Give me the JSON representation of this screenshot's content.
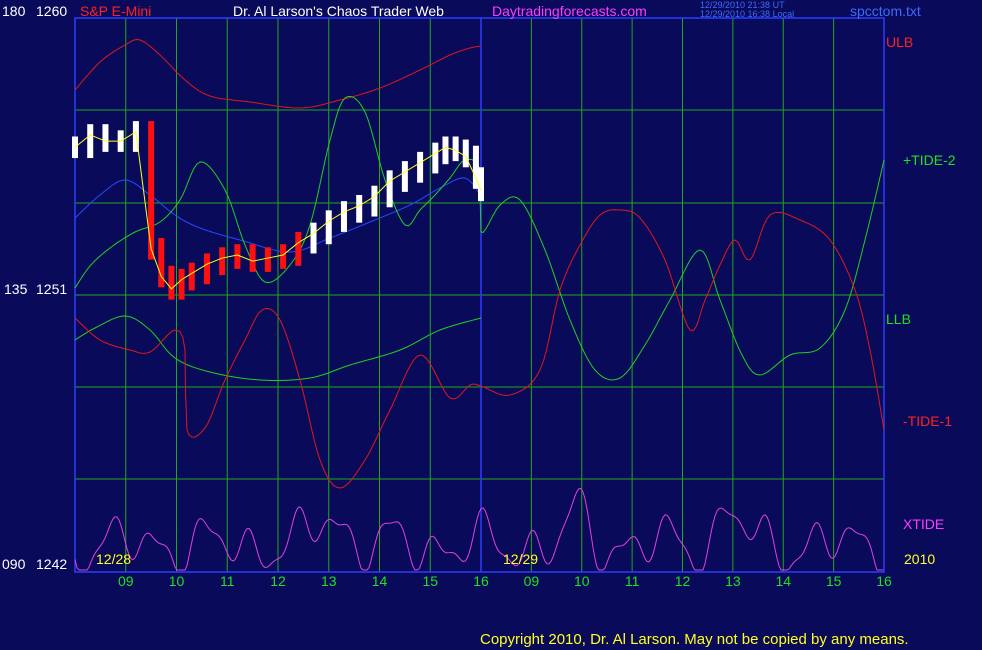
{
  "header": {
    "y_left_top": "180",
    "y_price_top": "1260",
    "symbol": "S&P E-Mini",
    "title": "Dr. Al Larson's Chaos Trader Web",
    "website": "Daytradingforecasts.com",
    "stamp_ut": "12/29/2010 21:38 UT",
    "stamp_local": "12/29/2010 16:38 Local",
    "filename": "spcctom.txt"
  },
  "y_axis": {
    "mid_left": "135",
    "mid_price": "1251",
    "bottom_left": "090",
    "bottom_price": "1242"
  },
  "right_labels": {
    "ulb": "ULB",
    "tide2": "+TIDE-2",
    "llb": "LLB",
    "tide1": "-TIDE-1",
    "xtide": "XTIDE",
    "year": "2010"
  },
  "dates": {
    "d1": "12/28",
    "d2": "12/29"
  },
  "footer": {
    "copyright": "Copyright 2010, Dr. Al Larson. May not be copied by any means."
  },
  "colors": {
    "background": "#0a0a5a",
    "grid": "#1ea81e",
    "frame": "#2a3cff",
    "ulb_llb_red": "#e01818",
    "green": "#20d020",
    "magenta": "#e040e0",
    "price_white": "#ffffff",
    "price_red": "#ff1010",
    "yellow": "#ffff20",
    "blue_avg": "#2848ff"
  },
  "chart_data": {
    "type": "line",
    "title": "S&P E-Mini",
    "price_axis": {
      "ylim": [
        1242,
        1260
      ],
      "ticks": [
        1242,
        1251,
        1260
      ]
    },
    "secondary_axis": {
      "ylim": [
        90,
        180
      ],
      "ticks": [
        "090",
        "135",
        "180"
      ]
    },
    "x_axis_days": [
      "12/28",
      "12/29"
    ],
    "x_tick_labels": [
      "09",
      "10",
      "11",
      "12",
      "13",
      "14",
      "15",
      "16",
      "09",
      "10",
      "11",
      "12",
      "13",
      "14",
      "15",
      "16"
    ],
    "price_series": {
      "name": "S&P E-Mini",
      "x_hour": [
        8.0,
        8.3,
        8.6,
        8.9,
        9.2,
        9.5,
        9.7,
        9.9,
        10.1,
        10.3,
        10.6,
        10.9,
        11.2,
        11.5,
        11.8,
        12.1,
        12.4,
        12.7,
        13.0,
        13.3,
        13.6,
        13.9,
        14.2,
        14.5,
        14.8,
        15.1,
        15.3,
        15.5,
        15.7,
        15.9,
        16.0
      ],
      "close": [
        1255.8,
        1256.2,
        1256.0,
        1256.0,
        1256.3,
        1252.5,
        1251.6,
        1251.2,
        1251.5,
        1251.7,
        1252.0,
        1252.2,
        1252.3,
        1252.1,
        1252.2,
        1252.3,
        1252.7,
        1253.0,
        1253.4,
        1253.7,
        1253.9,
        1254.2,
        1254.7,
        1255.0,
        1255.3,
        1255.6,
        1255.8,
        1255.7,
        1255.5,
        1254.8,
        1254.4
      ],
      "highlighted_red_hours": [
        9.5,
        12.5
      ]
    },
    "series": [
      {
        "name": "ULB"
      },
      {
        "name": "+TIDE-2"
      },
      {
        "name": "LLB"
      },
      {
        "name": "-TIDE-1"
      },
      {
        "name": "XTIDE"
      }
    ]
  }
}
